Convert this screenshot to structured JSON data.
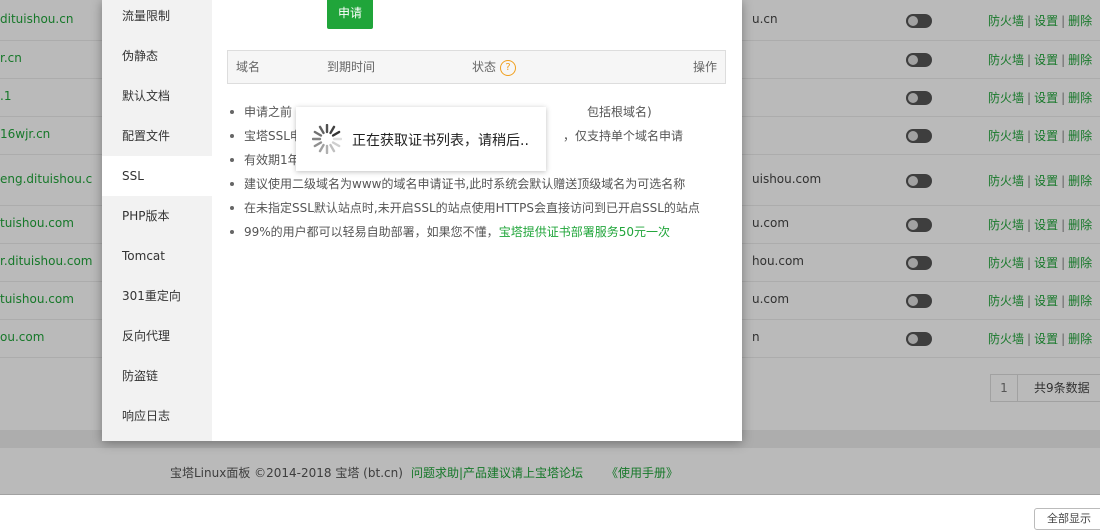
{
  "site_list": {
    "rows": [
      {
        "name": "dituishou.cn",
        "mid": "u.cn"
      },
      {
        "name": "r.cn",
        "mid": ""
      },
      {
        "name": ".1",
        "mid": ""
      },
      {
        "name": "16wjr.cn",
        "mid": ""
      },
      {
        "name": "eng.dituishou.c",
        "mid": "uishou.com"
      },
      {
        "name": "tuishou.com",
        "mid": "u.com"
      },
      {
        "name": "r.dituishou.com",
        "mid": "hou.com"
      },
      {
        "name": "tuishou.com",
        "mid": "u.com"
      },
      {
        "name": "ou.com",
        "mid": "n"
      }
    ],
    "actions": {
      "firewall": "防火墙",
      "settings": "设置",
      "delete": "删除",
      "separator": "|"
    },
    "pager": {
      "page": "1",
      "total": "共9条数据"
    }
  },
  "footer": {
    "copyright": "宝塔Linux面板 ©2014-2018 宝塔 (bt.cn)",
    "help": "问题求助|产品建议请上宝塔论坛",
    "manual": "《使用手册》"
  },
  "corner_button": "全部显示",
  "dialog": {
    "menu": [
      "流量限制",
      "伪静态",
      "默认文档",
      "配置文件",
      "SSL",
      "PHP版本",
      "Tomcat",
      "301重定向",
      "反向代理",
      "防盗链",
      "响应日志"
    ],
    "active_menu_index": 4,
    "apply_button": "申请",
    "table_headers": {
      "domain": "域名",
      "expiry": "到期时间",
      "status": "状态",
      "status_help": "?",
      "action": "操作"
    },
    "tips": [
      {
        "text": "申请之前",
        "tail": "包括根域名)"
      },
      {
        "text": "宝塔SSL申",
        "tail": "，仅支持单个域名申请"
      },
      {
        "text": "有效期1年",
        "tail": ""
      },
      {
        "text": "建议使用二级域名为www的域名申请证书,此时系统会默认赠送顶级域名为可选名称",
        "tail": ""
      },
      {
        "text": "在未指定SSL默认站点时,未开启SSL的站点使用HTTPS会直接访问到已开启SSL的站点",
        "tail": ""
      },
      {
        "text": "99%的用户都可以轻易自助部署，如果您不懂，",
        "link": "宝塔提供证书部署服务50元一次"
      }
    ]
  },
  "loading": {
    "text": "正在获取证书列表，请稍后.."
  },
  "colors": {
    "accent": "#20a53a",
    "warning": "#f0a020",
    "overlay": "rgba(0,0,0,0.27)"
  }
}
